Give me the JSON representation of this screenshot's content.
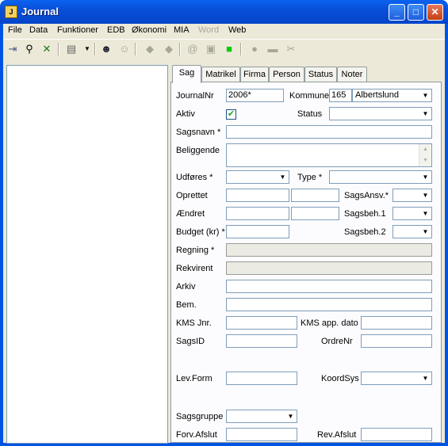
{
  "window": {
    "title": "Journal",
    "icon_letter": "J"
  },
  "menu": [
    "File",
    "Data",
    "Funktioner",
    "EDB",
    "Økonomi",
    "MIA",
    "Word",
    "Web"
  ],
  "toolbar_icons": [
    "insert-row-icon",
    "search-icon",
    "excel-export-icon",
    "grid-view-icon",
    "dropdown-arrow-icon",
    "user-icon",
    "user-disabled-icon",
    "eraser-icon",
    "eraser2-icon",
    "email-icon",
    "image-icon",
    "green-square-icon",
    "piggybank-icon",
    "stamp-icon",
    "tools-icon"
  ],
  "tabs": [
    "Sag",
    "Matrikel",
    "Firma",
    "Person",
    "Status",
    "Noter"
  ],
  "form": {
    "journalnr_label": "JournalNr",
    "journalnr_value": "2006*",
    "kommune_label": "Kommune",
    "kommune_code": "165",
    "kommune_name": "Albertslund",
    "aktiv_label": "Aktiv",
    "aktiv_checked": "✔",
    "status_label": "Status",
    "status_value": "",
    "sagsnavn_label": "Sagsnavn *",
    "sagsnavn_value": "",
    "beliggende_label": "Beliggende",
    "beliggende_value": "",
    "udfores_label": "Udføres *",
    "udfores_value": "",
    "type_label": "Type *",
    "type_value": "",
    "oprettet_label": "Oprettet",
    "oprettet_date": "",
    "oprettet_by": "",
    "sagsansv_label": "SagsAnsv.*",
    "sagsansv_value": "",
    "aendret_label": "Ændret",
    "aendret_date": "",
    "aendret_by": "",
    "sagsbeh1_label": "Sagsbeh.1",
    "sagsbeh1_value": "",
    "budget_label": "Budget (kr) *",
    "budget_value": "",
    "sagsbeh2_label": "Sagsbeh.2",
    "sagsbeh2_value": "",
    "regning_label": "Regning *",
    "regning_value": "",
    "rekvirent_label": "Rekvirent",
    "rekvirent_value": "",
    "arkiv_label": "Arkiv",
    "arkiv_value": "",
    "bem_label": "Bem.",
    "bem_value": "",
    "kmsjnr_label": "KMS Jnr.",
    "kmsjnr_value": "",
    "kmsapp_label": "KMS app. dato",
    "kmsapp_value": "",
    "sagsid_label": "SagsID",
    "sagsid_value": "",
    "ordrenr_label": "OrdreNr",
    "ordrenr_value": "",
    "levform_label": "Lev.Form",
    "levform_value": "",
    "koordsys_label": "KoordSys",
    "koordsys_value": "",
    "sagsgruppe_label": "Sagsgruppe",
    "sagsgruppe_value": "",
    "forvafslut_label": "Forv.Afslut",
    "forvafslut_value": "",
    "revafslut_label": "Rev.Afslut",
    "revafslut_value": ""
  },
  "colors": {
    "titlebar": "#0a4fd8",
    "client": "#ece9d8",
    "tab_panel": "#fcfcfe",
    "input_border": "#7f9db9",
    "readonly_input": "#ebebe4"
  }
}
